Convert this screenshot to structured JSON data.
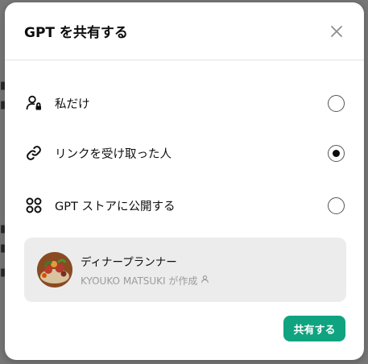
{
  "dialog": {
    "title": "GPT を共有する",
    "close_icon": "close-icon"
  },
  "options": [
    {
      "label": "私だけ",
      "icon": "person-lock-icon",
      "selected": false
    },
    {
      "label": "リンクを受け取った人",
      "icon": "link-icon",
      "selected": true
    },
    {
      "label": "GPT ストアに公開する",
      "icon": "grid-circles-icon",
      "selected": false
    }
  ],
  "gpt_card": {
    "name": "ディナープランナー",
    "author": "KYOUKO MATSUKI が作成",
    "author_icon": "person-icon"
  },
  "footer": {
    "share_label": "共有する"
  },
  "colors": {
    "accent": "#10a37f",
    "card_bg": "#ececec"
  }
}
